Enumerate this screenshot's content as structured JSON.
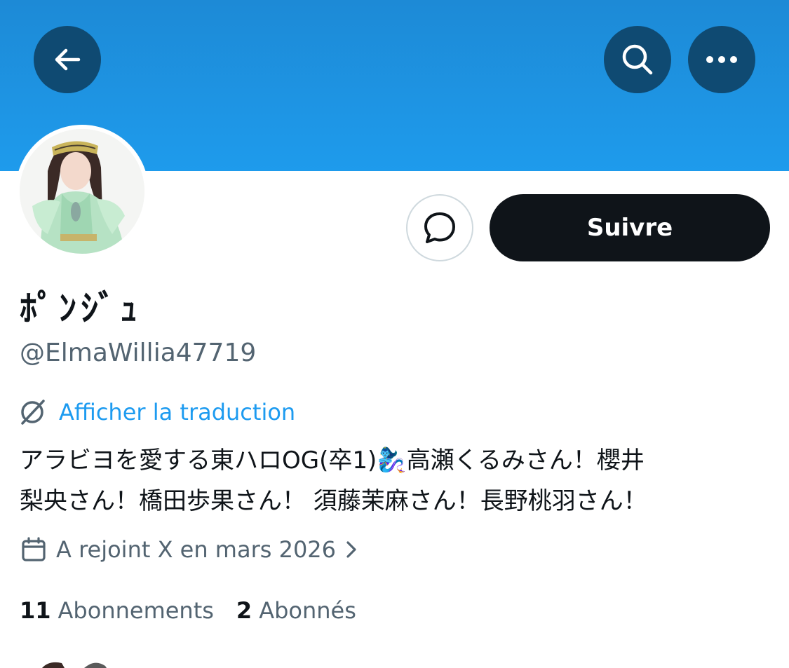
{
  "header": {
    "back_icon": "arrow-left-icon",
    "search_icon": "search-icon",
    "more_icon": "more-horizontal-icon",
    "banner_color": "#1e96e4",
    "button_color": "#0f4a72"
  },
  "profile": {
    "display_name": "ﾎﾟﾝｼﾞｭ",
    "handle": "@ElmaWillia47719",
    "follow_label": "Suivre",
    "message_icon": "message-bubble-icon",
    "translate_label": "Afficher la traduction",
    "bio_line1": "アラビヨを愛する東ハロOG(卒1)🧞‍♀️高瀬くるみさん！櫻井",
    "bio_line2": "梨央さん！橋田歩果さん！ 須藤茉麻さん！長野桃羽さん！",
    "joined": "A rejoint X en mars 2026",
    "following_count": "11",
    "following_label": "Abonnements",
    "followers_count": "2",
    "followers_label": "Abonnés",
    "accent_color": "#1d9bf0",
    "text_color": "#0f1419",
    "muted_color": "#536471"
  }
}
